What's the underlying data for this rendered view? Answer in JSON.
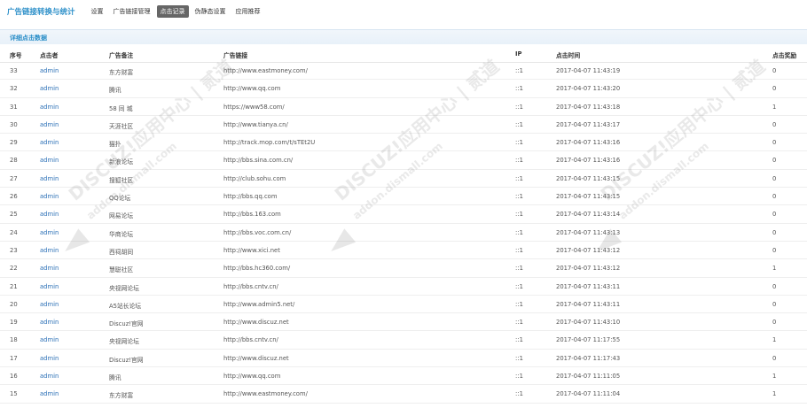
{
  "header": {
    "title": "广告链接转换与统计",
    "nav": [
      {
        "label": "设置",
        "active": false
      },
      {
        "label": "广告链接管理",
        "active": false
      },
      {
        "label": "点击记录",
        "active": true
      },
      {
        "label": "伪静态设置",
        "active": false
      },
      {
        "label": "应用推荐",
        "active": false
      }
    ]
  },
  "section": {
    "title": "详细点击数据"
  },
  "table": {
    "columns": [
      "序号",
      "点击者",
      "广告备注",
      "广告链接",
      "IP",
      "点击时间",
      "点击奖励"
    ],
    "rows": [
      [
        "33",
        "admin",
        "东方财富",
        "http://www.eastmoney.com/",
        "::1",
        "2017-04-07 11:43:19",
        "0"
      ],
      [
        "32",
        "admin",
        "腾讯",
        "http://www.qq.com",
        "::1",
        "2017-04-07 11:43:20",
        "0"
      ],
      [
        "31",
        "admin",
        "58 同 城",
        "https://www58.com/",
        "::1",
        "2017-04-07 11:43:18",
        "1"
      ],
      [
        "30",
        "admin",
        "天涯社区",
        "http://www.tianya.cn/",
        "::1",
        "2017-04-07 11:43:17",
        "0"
      ],
      [
        "29",
        "admin",
        "猫扑",
        "http://track.mop.com/t/sTEt2U",
        "::1",
        "2017-04-07 11:43:16",
        "0"
      ],
      [
        "28",
        "admin",
        "新浪论坛",
        "http://bbs.sina.com.cn/",
        "::1",
        "2017-04-07 11:43:16",
        "0"
      ],
      [
        "27",
        "admin",
        "搜狐社区",
        "http://club.sohu.com",
        "::1",
        "2017-04-07 11:43:15",
        "0"
      ],
      [
        "26",
        "admin",
        "QQ论坛",
        "http://bbs.qq.com",
        "::1",
        "2017-04-07 11:43:15",
        "0"
      ],
      [
        "25",
        "admin",
        "网易论坛",
        "http://bbs.163.com",
        "::1",
        "2017-04-07 11:43:14",
        "0"
      ],
      [
        "24",
        "admin",
        "华商论坛",
        "http://bbs.voc.com.cn/",
        "::1",
        "2017-04-07 11:43:13",
        "0"
      ],
      [
        "23",
        "admin",
        "西祠胡同",
        "http://www.xici.net",
        "::1",
        "2017-04-07 11:43:12",
        "0"
      ],
      [
        "22",
        "admin",
        "慧聪社区",
        "http://bbs.hc360.com/",
        "::1",
        "2017-04-07 11:43:12",
        "1"
      ],
      [
        "21",
        "admin",
        "央视网论坛",
        "http://bbs.cntv.cn/",
        "::1",
        "2017-04-07 11:43:11",
        "0"
      ],
      [
        "20",
        "admin",
        "A5站长论坛",
        "http://www.admin5.net/",
        "::1",
        "2017-04-07 11:43:11",
        "0"
      ],
      [
        "19",
        "admin",
        "Discuz!官网",
        "http://www.discuz.net",
        "::1",
        "2017-04-07 11:43:10",
        "0"
      ],
      [
        "18",
        "admin",
        "央视网论坛",
        "http://bbs.cntv.cn/",
        "::1",
        "2017-04-07 11:17:55",
        "1"
      ],
      [
        "17",
        "admin",
        "Discuz!官网",
        "http://www.discuz.net",
        "::1",
        "2017-04-07 11:17:43",
        "0"
      ],
      [
        "16",
        "admin",
        "腾讯",
        "http://www.qq.com",
        "::1",
        "2017-04-07 11:11:05",
        "1"
      ],
      [
        "15",
        "admin",
        "东方财富",
        "http://www.eastmoney.com/",
        "::1",
        "2017-04-07 11:11:04",
        "1"
      ]
    ]
  },
  "watermark": {
    "brand": "DISCUZ!应用中心 | 贰道",
    "url": "addon.dismall.com"
  },
  "colors": {
    "accent": "#2a8ec8",
    "active_tab_bg": "#666666",
    "user_link": "#2a6fb6"
  }
}
